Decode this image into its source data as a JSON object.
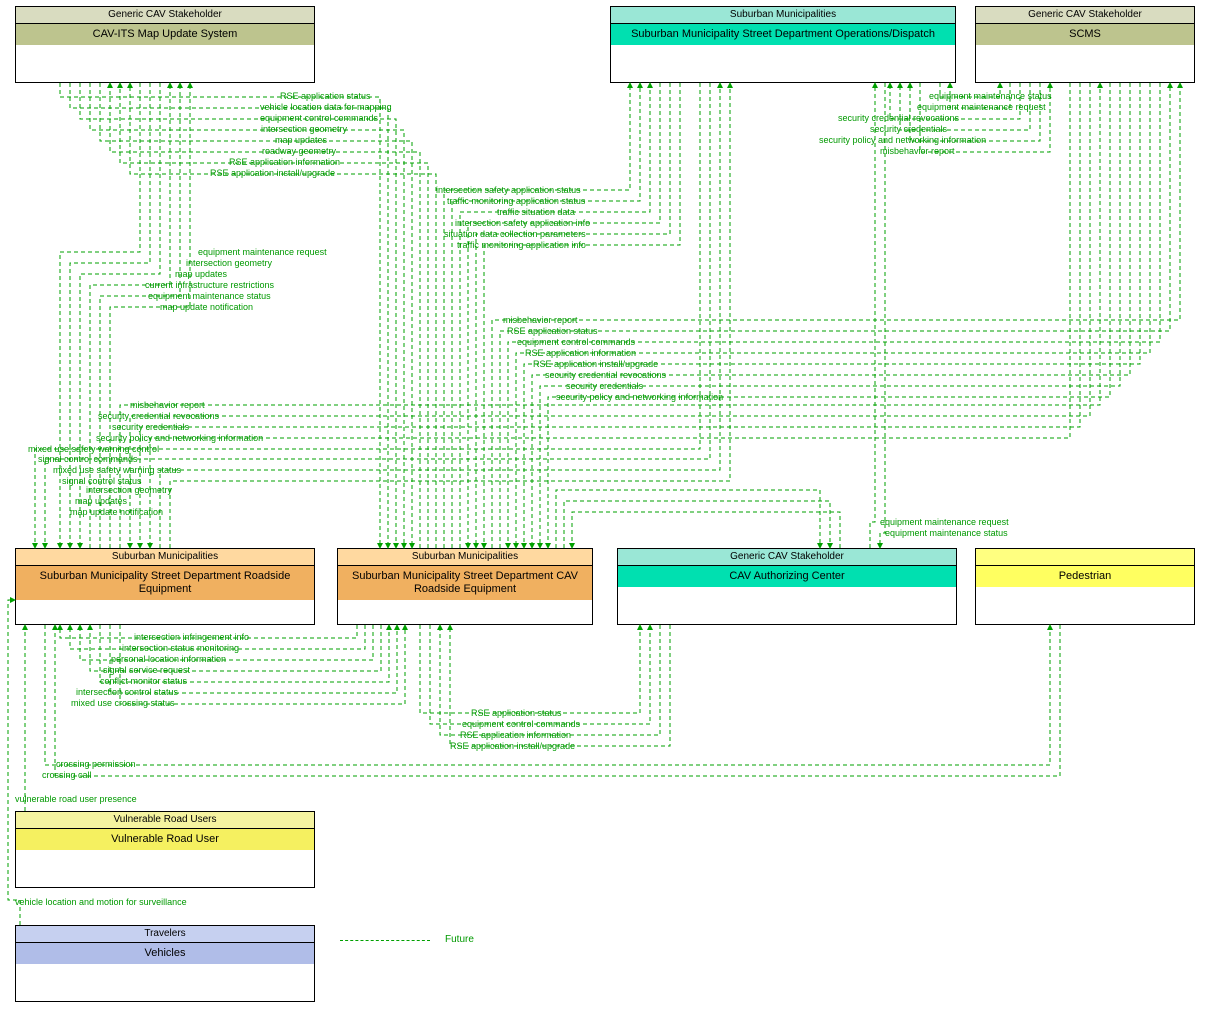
{
  "nodes": {
    "cav_its_map": {
      "stakeholder": "Generic CAV Stakeholder",
      "name": "CAV-ITS Map Update System"
    },
    "suburban_ops": {
      "stakeholder": "Suburban Municipalities",
      "name": "Suburban Municipality Street Department Operations/Dispatch"
    },
    "scms": {
      "stakeholder": "Generic CAV Stakeholder",
      "name": "SCMS"
    },
    "roadside_equip": {
      "stakeholder": "Suburban Municipalities",
      "name": "Suburban Municipality Street Department Roadside Equipment"
    },
    "cav_roadside": {
      "stakeholder": "Suburban Municipalities",
      "name": "Suburban Municipality Street Department CAV Roadside Equipment"
    },
    "cav_auth": {
      "stakeholder": "Generic CAV Stakeholder",
      "name": "CAV Authorizing Center"
    },
    "pedestrian": {
      "stakeholder": "",
      "name": "Pedestrian"
    },
    "vru": {
      "stakeholder": "Vulnerable Road Users",
      "name": "Vulnerable Road User"
    },
    "vehicles": {
      "stakeholder": "Travelers",
      "name": "Vehicles"
    }
  },
  "flows": {
    "rse_app_status_1": "RSE application status",
    "vehicle_loc_mapping": "vehicle location data for mapping",
    "equip_ctrl_cmds_1": "equipment control commands",
    "intersection_geom_1": "intersection geometry",
    "map_updates_1": "map updates",
    "roadway_geom": "roadway geometry",
    "rse_app_info_1": "RSE application information",
    "rse_app_install_1": "RSE application install/upgrade",
    "int_safety_status": "intersection safety application status",
    "traffic_mon_status": "traffic monitoring application status",
    "traffic_sit_data": "traffic situation data",
    "int_safety_info": "intersection safety application info",
    "sit_data_params": "situation data collection parameters",
    "traffic_mon_info": "traffic monitoring application info",
    "equip_maint_req_1": "equipment maintenance request",
    "intersection_geom_2": "intersection geometry",
    "map_updates_2": "map updates",
    "curr_infra_restrict": "current infrastructure restrictions",
    "equip_maint_status_1": "equipment maintenance status",
    "map_update_notif_1": "map update notification",
    "misbehavior_1": "misbehavior report",
    "rse_app_status_2": "RSE application status",
    "equip_ctrl_cmds_2": "equipment control commands",
    "rse_app_info_2": "RSE application information",
    "rse_app_install_2": "RSE application install/upgrade",
    "sec_cred_revoc_1": "security credential revocations",
    "sec_creds_1": "security credentials",
    "sec_policy_1": "security policy and networking information",
    "misbehavior_2": "misbehavior report",
    "sec_cred_revoc_2": "security credential revocations",
    "sec_creds_2": "security credentials",
    "sec_policy_2": "security policy and networking information",
    "mixed_use_ctrl": "mixed use safety warning control",
    "signal_ctrl_cmds": "signal control commands",
    "mixed_use_status": "mixed use safety warning status",
    "signal_ctrl_status": "signal control status",
    "intersection_geom_3": "intersection geometry",
    "map_updates_3": "map updates",
    "map_update_notif_2": "map update notification",
    "int_infringe": "intersection infringement info",
    "int_status_mon": "intersection status monitoring",
    "pers_loc_info": "personal location information",
    "sig_svc_req": "signal service request",
    "conflict_mon": "conflict monitor status",
    "int_ctrl_status": "intersection control status",
    "mixed_use_cross": "mixed use crossing status",
    "rse_app_status_3": "RSE application status",
    "equip_ctrl_cmds_3": "equipment control commands",
    "rse_app_info_3": "RSE application information",
    "rse_app_install_3": "RSE application install/upgrade",
    "crossing_perm": "crossing permission",
    "crossing_call": "crossing call",
    "vru_presence": "vulnerable road user presence",
    "vehicle_loc_surv": "vehicle location and motion for surveillance",
    "equip_maint_status_2": "equipment maintenance status",
    "equip_maint_req_2": "equipment maintenance request",
    "sec_cred_revoc_3": "security credential revocations",
    "sec_creds_3": "security credentials",
    "sec_policy_3": "security policy and networking information",
    "misbehavior_3": "misbehavior report",
    "equip_maint_req_3": "equipment maintenance request",
    "equip_maint_status_3": "equipment maintenance status"
  },
  "legend": {
    "future": "Future"
  }
}
